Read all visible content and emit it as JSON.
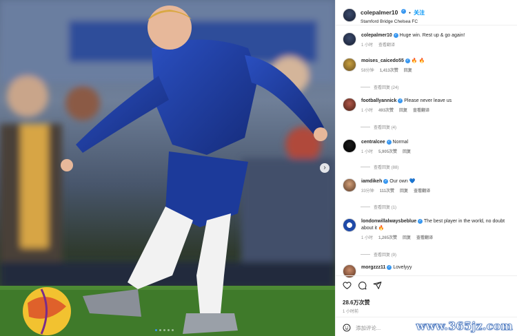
{
  "post": {
    "username": "colepalmer10",
    "follow_label": "关注",
    "location": "Stamford Bridge Chelsea FC",
    "caption": "Huge win. Rest up & go again!",
    "caption_time": "1 小时",
    "caption_translate": "查看翻译"
  },
  "comments": [
    {
      "user": "moises_caicedo55",
      "text": "🔥 🔥",
      "time": "58分钟",
      "likes": "1,413次赞",
      "reply": "回复",
      "view_replies": "查看回复 (24)"
    },
    {
      "user": "footballyannick",
      "text": "Please never leave us",
      "time": "1 小时",
      "likes": "493次赞",
      "reply": "回复",
      "translate": "查看翻译",
      "view_replies": "查看回复 (4)"
    },
    {
      "user": "centralcee",
      "text": "Normal",
      "time": "1 小时",
      "likes": "5,905次赞",
      "reply": "回复",
      "view_replies": "查看回复 (88)"
    },
    {
      "user": "iamdikeh",
      "text": "Our own 💙",
      "time": "33分钟",
      "likes": "111次赞",
      "reply": "回复",
      "translate": "查看翻译",
      "view_replies": "查看回复 (1)"
    },
    {
      "user": "londonwillalwaysbeblue",
      "text": "The best player in the world, no doubt about it 🔥",
      "time": "1 小时",
      "likes": "1,265次赞",
      "reply": "回复",
      "translate": "查看翻译",
      "view_replies": "查看回复 (9)"
    },
    {
      "user": "morgzzz11",
      "text": "Lovelyyy"
    }
  ],
  "footer": {
    "likes": "28.6万次赞",
    "posted": "1 小时前",
    "add_comment_placeholder": "添加评论..."
  },
  "icons": {
    "like": "heart-icon",
    "comment": "comment-icon",
    "share": "send-icon",
    "carousel": "chevron-right-icon"
  },
  "colors": {
    "link_blue": "#0095f6",
    "verified_blue": "#3897f0",
    "chelsea_blue": "#1f3fa8"
  },
  "watermark": "www.365jz.com"
}
